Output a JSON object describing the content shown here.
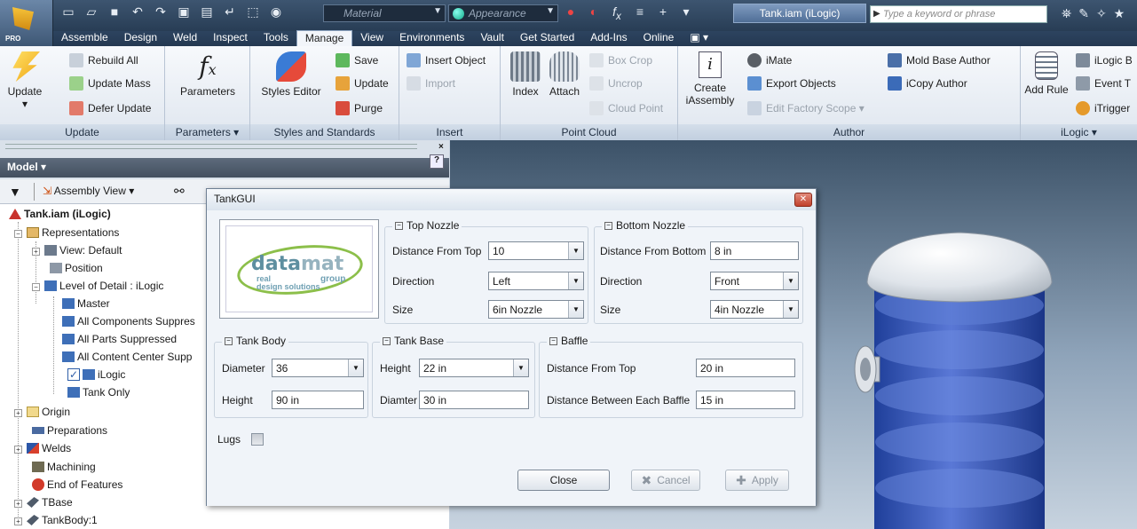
{
  "window": {
    "title": "Tank.iam (iLogic)",
    "search_placeholder": "Type a keyword or phrase",
    "material_combo": "Material",
    "appearance_combo": "Appearance",
    "app_badge": "PRO"
  },
  "menu_tabs": [
    "Assemble",
    "Design",
    "Weld",
    "Inspect",
    "Tools",
    "Manage",
    "View",
    "Environments",
    "Vault",
    "Get Started",
    "Add-Ins",
    "Online"
  ],
  "active_tab": "Manage",
  "ribbon": {
    "update": {
      "title": "Update",
      "update_btn": "Update",
      "rebuild_all": "Rebuild All",
      "update_mass": "Update Mass",
      "defer_update": "Defer Update"
    },
    "parameters": {
      "title": "Parameters ▾",
      "parameters_btn": "Parameters"
    },
    "styles": {
      "title": "Styles and Standards",
      "styles_editor": "Styles Editor",
      "save": "Save",
      "update": "Update",
      "purge": "Purge"
    },
    "insert": {
      "title": "Insert",
      "insert_object": "Insert Object",
      "import": "Import"
    },
    "point_cloud": {
      "title": "Point Cloud",
      "index": "Index",
      "attach": "Attach",
      "box_crop": "Box Crop",
      "uncrop": "Uncrop",
      "cloud_point": "Cloud Point"
    },
    "author": {
      "title": "Author",
      "create": "Create",
      "iassembly": "iAssembly",
      "imate": "iMate",
      "export_objects": "Export Objects",
      "edit_factory_scope": "Edit Factory Scope ▾",
      "mold_base_author": "Mold Base Author",
      "icopy_author": "iCopy Author"
    },
    "ilogic": {
      "title": "iLogic ▾",
      "add_rule": "Add Rule",
      "ilogic_b": "iLogic B",
      "event_t": "Event T",
      "itrigger": "iTrigger"
    }
  },
  "browser": {
    "title": "Model ▾",
    "view_selector": "Assembly View ▾",
    "help": "?",
    "close": "×",
    "tree": [
      {
        "label": "Tank.iam (iLogic)"
      },
      {
        "label": "Representations"
      },
      {
        "label": "View: Default"
      },
      {
        "label": "Position"
      },
      {
        "label": "Level of Detail : iLogic"
      },
      {
        "label": "Master"
      },
      {
        "label": "All Components Suppres"
      },
      {
        "label": "All Parts Suppressed"
      },
      {
        "label": "All Content Center Supp"
      },
      {
        "label": "iLogic"
      },
      {
        "label": "Tank Only"
      },
      {
        "label": "Origin"
      },
      {
        "label": "Preparations"
      },
      {
        "label": "Welds"
      },
      {
        "label": "Machining"
      },
      {
        "label": "End of Features"
      },
      {
        "label": "TBase"
      },
      {
        "label": "TankBody:1"
      }
    ]
  },
  "dialog": {
    "title": "TankGUI",
    "logo": {
      "word_a": "data",
      "word_b": "mat",
      "sub1": "real",
      "sub2": "design solutions",
      "group": "group"
    },
    "top_nozzle": {
      "title": "Top Nozzle",
      "distance_label": "Distance From Top",
      "distance_value": "10",
      "direction_label": "Direction",
      "direction_value": "Left",
      "size_label": "Size",
      "size_value": "6in Nozzle"
    },
    "bottom_nozzle": {
      "title": "Bottom Nozzle",
      "distance_label": "Distance From Bottom",
      "distance_value": "8 in",
      "direction_label": "Direction",
      "direction_value": "Front",
      "size_label": "Size",
      "size_value": "4in Nozzle"
    },
    "tank_body": {
      "title": "Tank Body",
      "diameter_label": "Diameter",
      "diameter_value": "36",
      "height_label": "Height",
      "height_value": "90 in"
    },
    "tank_base": {
      "title": "Tank Base",
      "height_label": "Height",
      "height_value": "22 in",
      "diameter_label": "Diamter",
      "diameter_value": "30 in"
    },
    "baffle": {
      "title": "Baffle",
      "distance_label": "Distance From Top",
      "distance_value": "20 in",
      "between_label": "Distance Between Each Baffle",
      "between_value": "15 in"
    },
    "lugs_label": "Lugs",
    "close_btn": "Close",
    "cancel_btn": "Cancel",
    "apply_btn": "Apply"
  }
}
